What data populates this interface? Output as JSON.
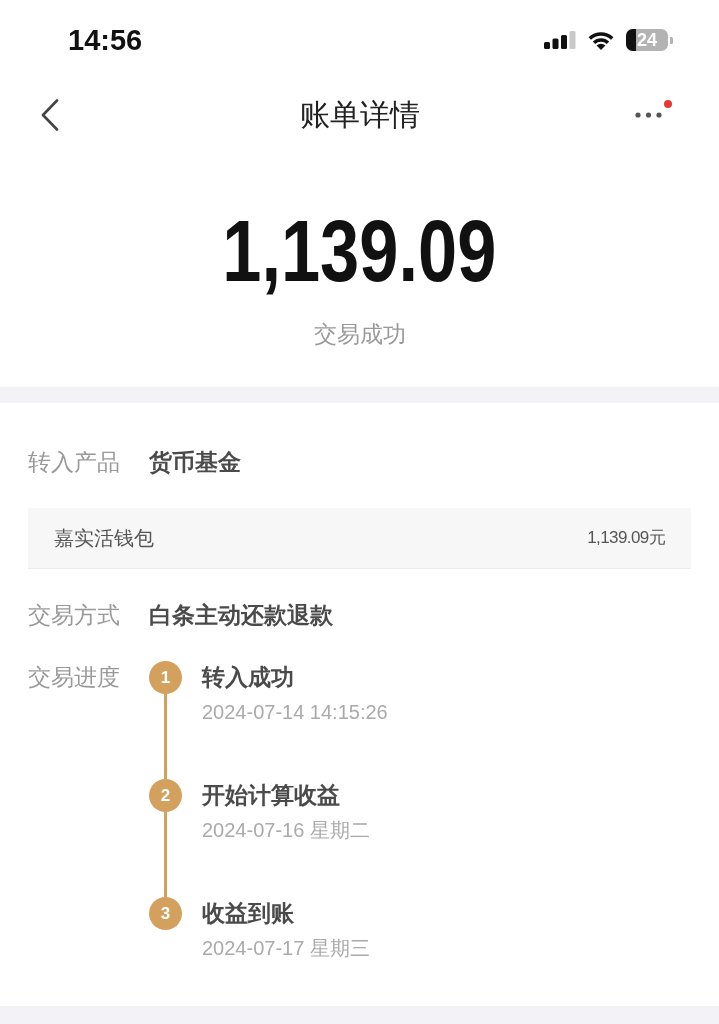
{
  "status_bar": {
    "time": "14:56",
    "battery": "24"
  },
  "nav": {
    "title": "账单详情",
    "more_button": {
      "has_badge": true
    }
  },
  "summary": {
    "amount": "1,139.09",
    "status": "交易成功"
  },
  "details": [
    {
      "kind": "row",
      "label": "转入产品",
      "value": "货币基金"
    },
    {
      "kind": "card",
      "name": "嘉实活钱包",
      "amount": "1,139.09元"
    },
    {
      "kind": "row",
      "label": "交易方式",
      "value": "白条主动还款退款"
    }
  ],
  "progress": {
    "label": "交易进度",
    "steps": [
      {
        "number": "1",
        "title": "转入成功",
        "time": "2024-07-14 14:15:26"
      },
      {
        "number": "2",
        "title": "开始计算收益",
        "time": "2024-07-16 星期二"
      },
      {
        "number": "3",
        "title": "收益到账",
        "time": "2024-07-17 星期三"
      }
    ]
  }
}
